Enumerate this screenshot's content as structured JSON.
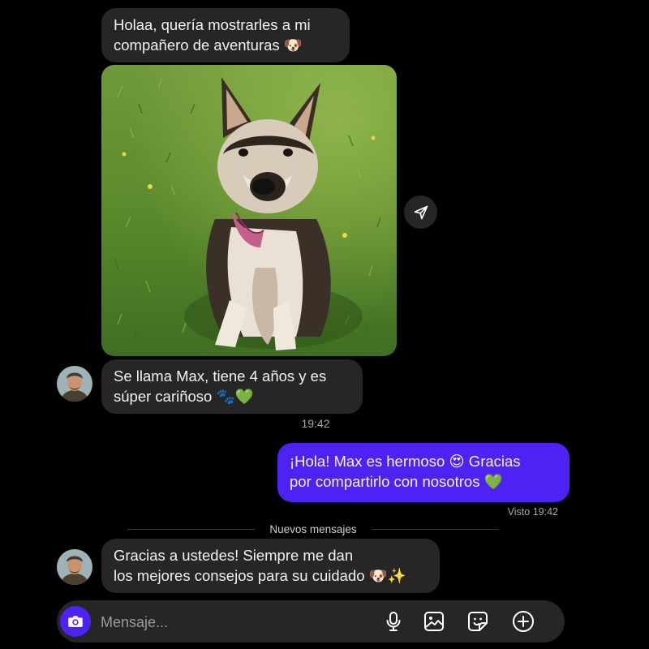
{
  "thread": {
    "messages": [
      {
        "from": "them",
        "lines": [
          "Holaa, quería mostrarles a mi",
          "compañero de aventuras 🐶"
        ]
      },
      {
        "from": "them",
        "type": "photo",
        "icon": "german-shepherd-dog-photo"
      },
      {
        "from": "them",
        "lines": [
          "Se llama Max, tiene 4 años y es",
          "súper cariñoso 🐾💚"
        ]
      },
      {
        "from": "me",
        "lines": [
          "¡Hola! Max es hermoso 😍 Gracias",
          "por compartirlo con nosotros 💚"
        ]
      },
      {
        "from": "them",
        "lines": [
          "Gracias a ustedes! Siempre me dan",
          "los mejores consejos para su cuidado 🐶✨"
        ]
      }
    ],
    "timestamp": "19:42",
    "seen_status": "Visto 19:42",
    "new_messages_label": "Nuevos mensajes"
  },
  "composer": {
    "placeholder": "Mensaje...",
    "icons": [
      "camera-icon",
      "microphone-icon",
      "gallery-icon",
      "sticker-icon",
      "plus-icon"
    ]
  },
  "colors": {
    "background": "#000000",
    "incoming_bubble": "#262626",
    "outgoing_bubble": "#4d22f2",
    "secondary_text": "#a8a8a8"
  }
}
